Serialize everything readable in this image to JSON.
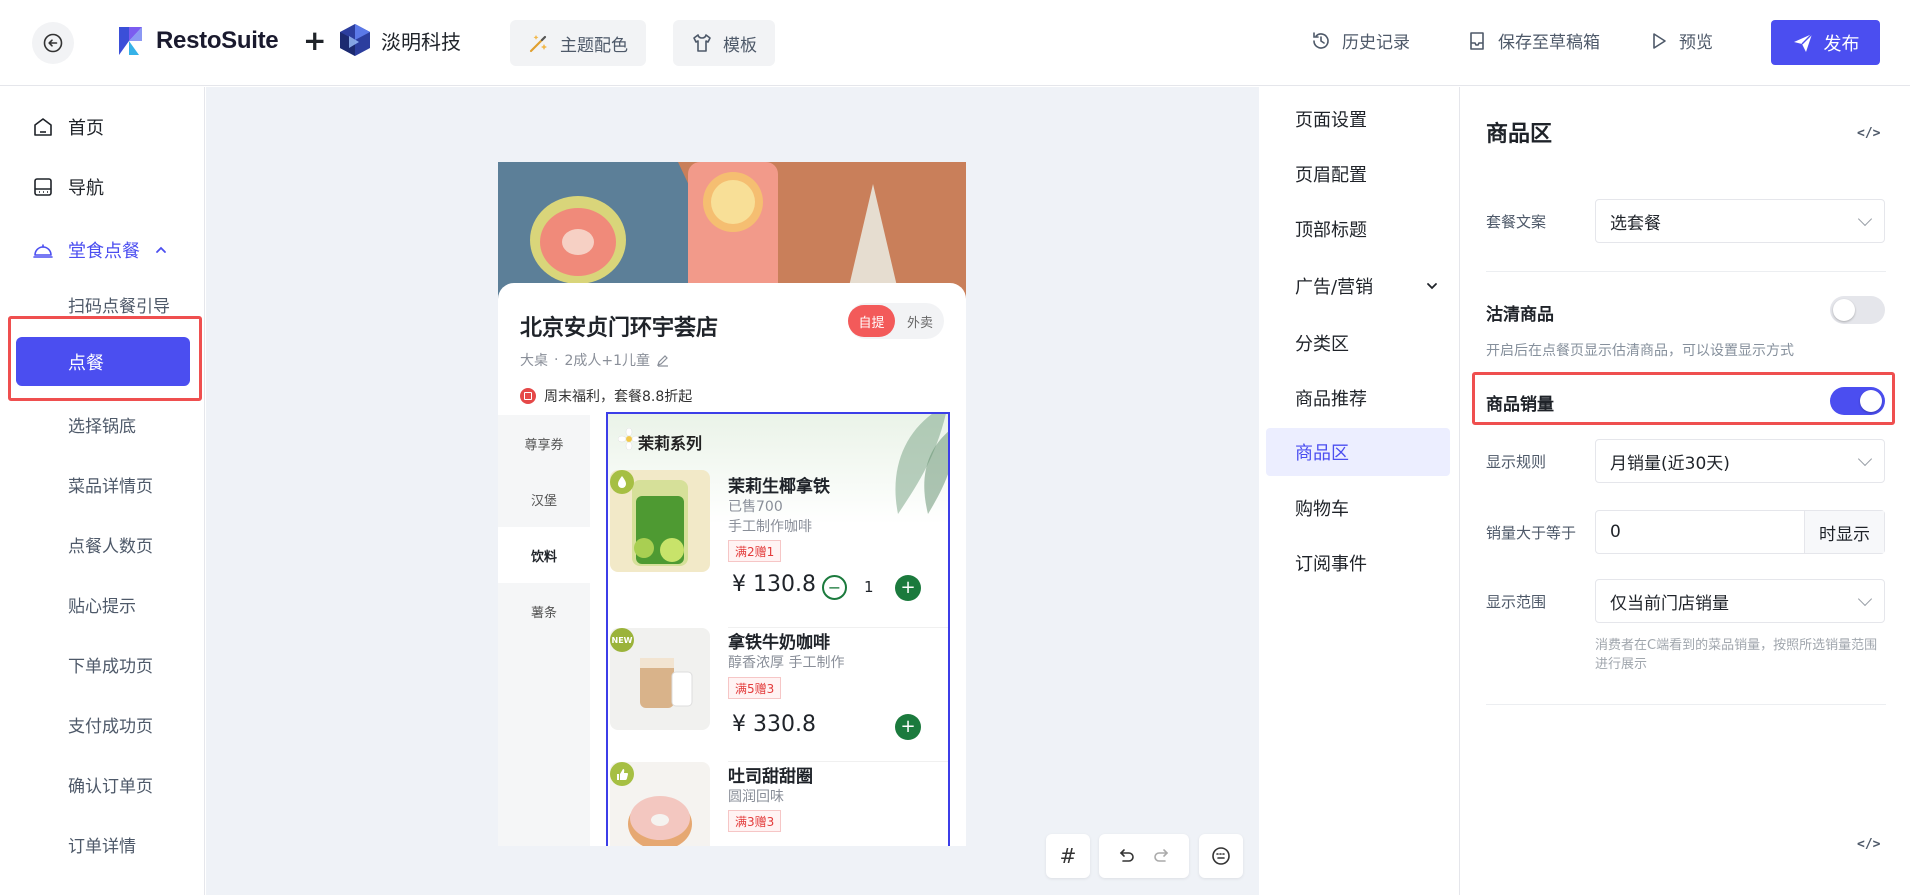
{
  "header": {
    "brand": "RestoSuite",
    "plus": "+",
    "partner": "淡明科技",
    "theme_label": "主题配色",
    "template_label": "模板",
    "history_label": "历史记录",
    "draft_label": "保存至草稿箱",
    "preview_label": "预览",
    "publish_label": "发布"
  },
  "sidebar": {
    "home": "首页",
    "nav": "导航",
    "dine_in": "堂食点餐",
    "sub_items": [
      "扫码点餐引导",
      "点餐",
      "选择锅底",
      "菜品详情页",
      "点餐人数页",
      "贴心提示",
      "下单成功页",
      "支付成功页",
      "确认订单页",
      "订单详情"
    ]
  },
  "phone": {
    "store_name": "北京安贞门环宇荟店",
    "mode_selected": "自提",
    "mode_other": "外卖",
    "meta_table": "大桌",
    "meta_people": "2成人+1儿童",
    "promo": "周末福利，套餐8.8折起",
    "categories": [
      "尊享券",
      "汉堡",
      "饮料",
      "薯条"
    ],
    "series_title": "茉莉系列",
    "products": [
      {
        "name": "茉莉生椰拿铁",
        "sold": "已售700",
        "desc": "手工制作咖啡",
        "tag": "满2赠1",
        "price": "¥ 130.8",
        "qty": "1"
      },
      {
        "name": "拿铁牛奶咖啡",
        "desc": "醇香浓厚 手工制作",
        "tag": "满5赠3",
        "price": "¥ 330.8",
        "badge": "NEW"
      },
      {
        "name": "吐司甜甜圈",
        "desc": "圆润回味",
        "tag": "满3赠3"
      }
    ]
  },
  "config_nav": {
    "items": [
      "页面设置",
      "页眉配置",
      "顶部标题",
      "广告/营销",
      "分类区",
      "商品推荐",
      "商品区",
      "购物车",
      "订阅事件"
    ],
    "active": "商品区"
  },
  "props": {
    "title": "商品区",
    "combo_label": "套餐文案",
    "combo_value": "选套餐",
    "soldout_label": "沽清商品",
    "soldout_hint": "开启后在点餐页显示估清商品，可以设置显示方式",
    "sales_label": "商品销量",
    "rule_label": "显示规则",
    "rule_value": "月销量(近30天)",
    "threshold_label": "销量大于等于",
    "threshold_value": "0",
    "threshold_suffix": "时显示",
    "scope_label": "显示范围",
    "scope_value": "仅当前门店销量",
    "scope_hint": "消费者在C端看到的菜品销量，按照所选销量范围进行展示"
  },
  "colors": {
    "accent": "#4b4ef0",
    "highlight_box": "#ef4f4f",
    "add_button": "#1b7a3d"
  }
}
